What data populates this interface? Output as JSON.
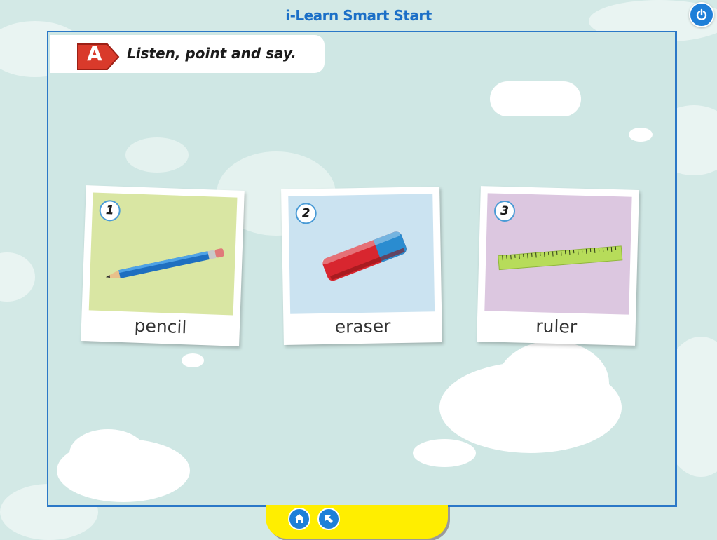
{
  "app": {
    "title": "i-Learn Smart Start"
  },
  "activity": {
    "badge_letter": "A",
    "instruction": "Listen, point and say."
  },
  "cards": [
    {
      "number": "1",
      "word": "pencil",
      "photo_color": "#d9e6a3",
      "icon": "pencil-icon"
    },
    {
      "number": "2",
      "word": "eraser",
      "photo_color": "#cbe3f1",
      "icon": "eraser-icon"
    },
    {
      "number": "3",
      "word": "ruler",
      "photo_color": "#dcc7e0",
      "icon": "ruler-icon"
    }
  ],
  "toolbar": {
    "power_icon": "power-icon",
    "home_icon": "home-icon",
    "back_icon": "arrow-back-icon"
  },
  "colors": {
    "brand_blue": "#1e7fd8",
    "title_blue": "#1b6fc7",
    "badge_red": "#d93a2b",
    "footer_yellow": "#ffee00",
    "background": "#d3e9e6"
  }
}
